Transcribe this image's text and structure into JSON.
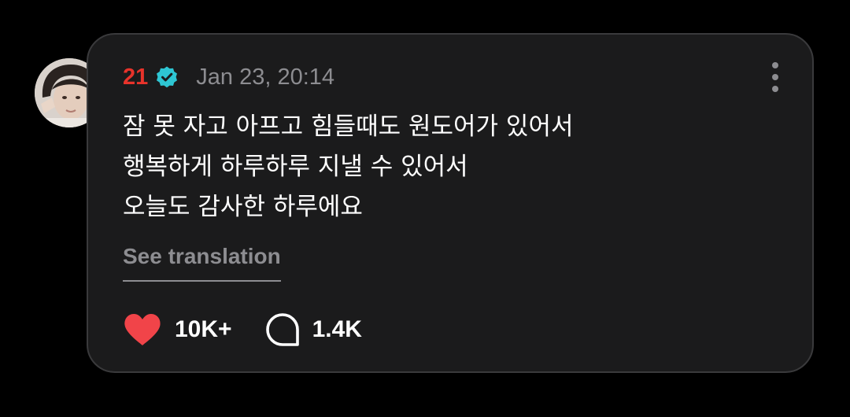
{
  "post": {
    "author": "21",
    "timestamp": "Jan 23, 20:14",
    "body_lines": [
      "잠 못 자고 아프고 힘들때도 원도어가 있어서",
      "행복하게 하루하루 지낼 수 있어서",
      "오늘도 감사한 하루에요"
    ],
    "translate_label": "See translation",
    "likes": "10K+",
    "comments": "1.4K"
  },
  "icons": {
    "verified": "verified-badge-icon",
    "more": "more-vertical-icon",
    "like": "heart-icon",
    "comment": "comment-bubble-icon"
  },
  "colors": {
    "author": "#e8332b",
    "verified": "#2ec6d3",
    "heart": "#f14449",
    "card_bg": "#1b1b1c",
    "muted_text": "#8d8d91"
  }
}
